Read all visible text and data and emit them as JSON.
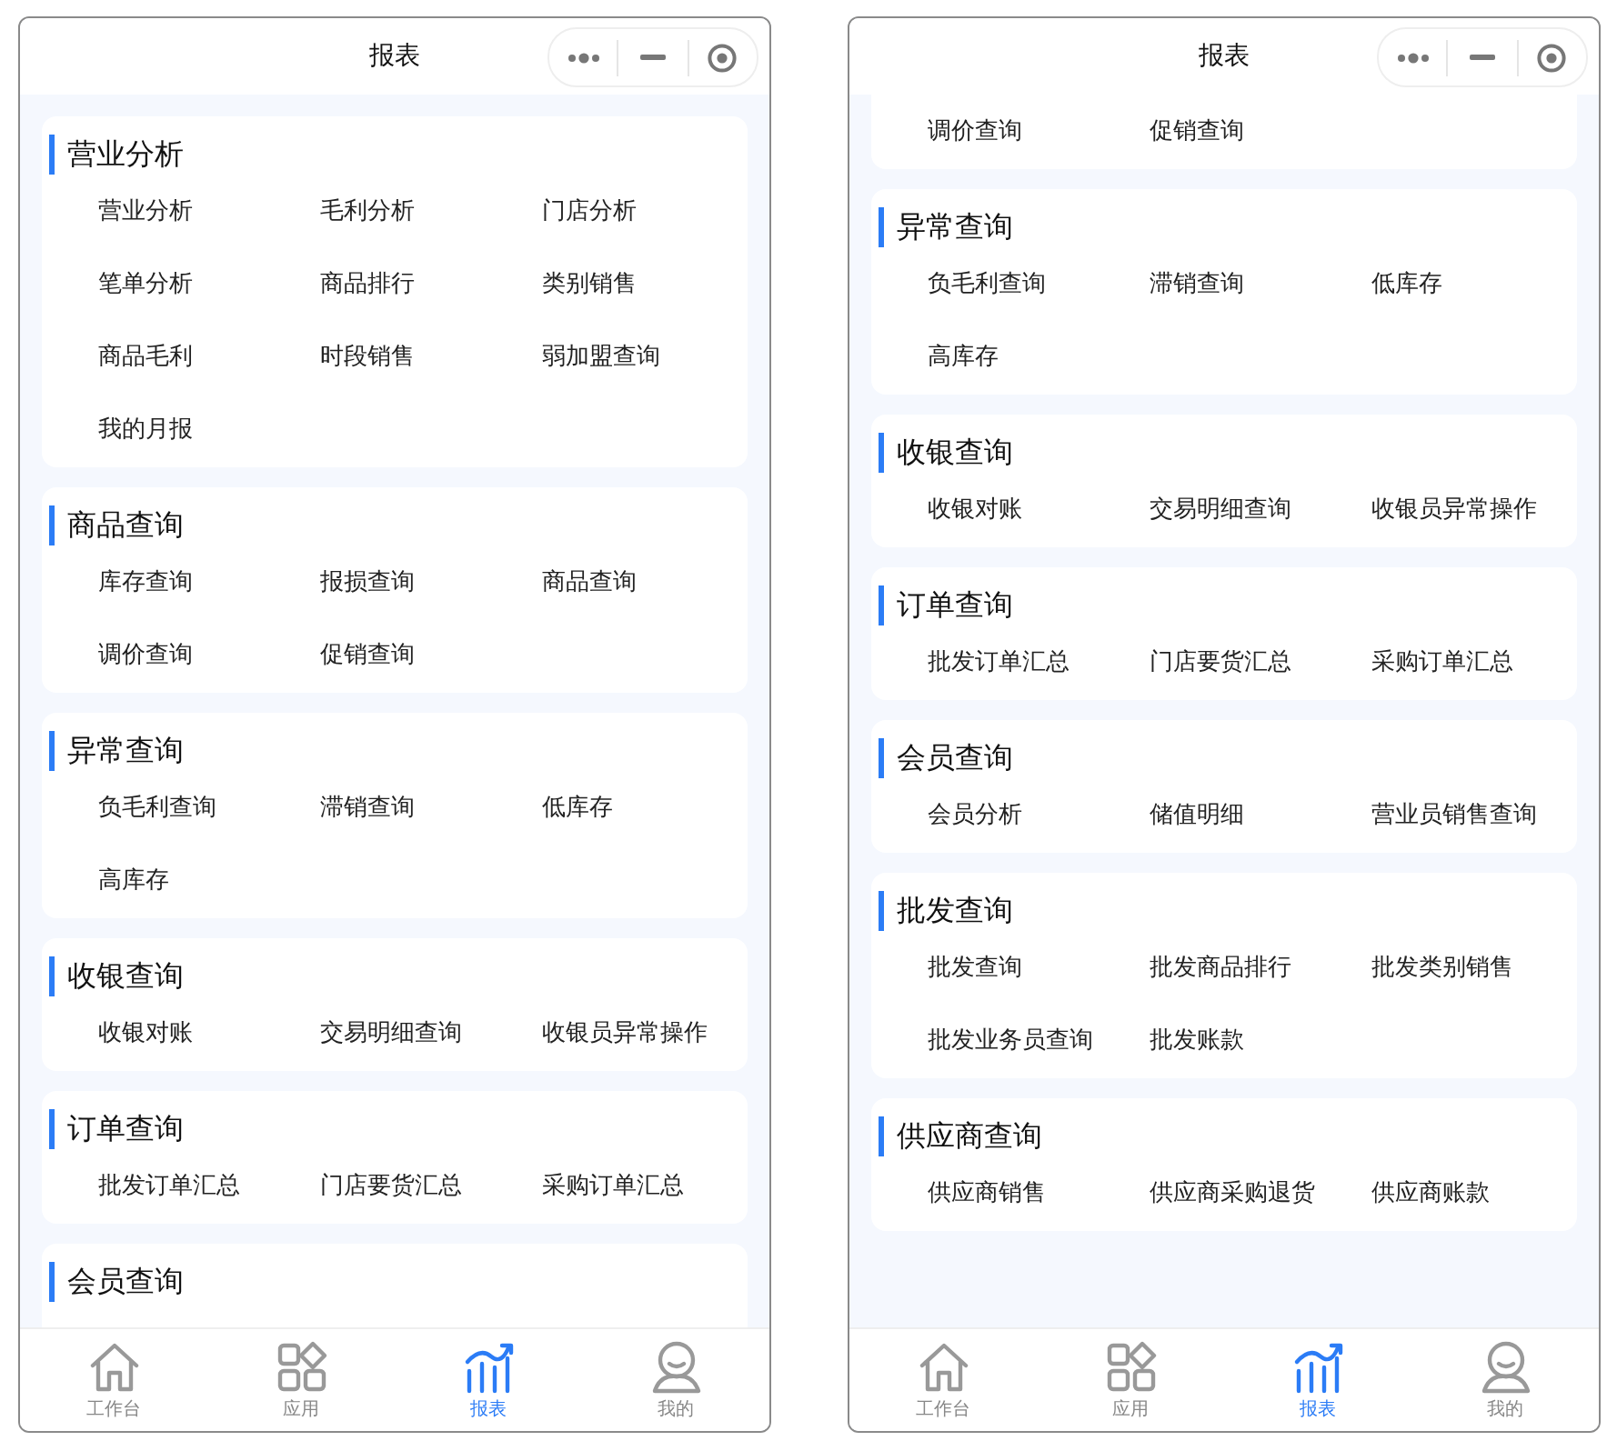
{
  "screens": [
    {
      "title": "报表",
      "sections": [
        {
          "title": "营业分析",
          "items": [
            "营业分析",
            "毛利分析",
            "门店分析",
            "笔单分析",
            "商品排行",
            "类别销售",
            "商品毛利",
            "时段销售",
            "弱加盟查询",
            "我的月报"
          ]
        },
        {
          "title": "商品查询",
          "items": [
            "库存查询",
            "报损查询",
            "商品查询",
            "调价查询",
            "促销查询"
          ]
        },
        {
          "title": "异常查询",
          "items": [
            "负毛利查询",
            "滞销查询",
            "低库存",
            "高库存"
          ]
        },
        {
          "title": "收银查询",
          "items": [
            "收银对账",
            "交易明细查询",
            "收银员异常操作"
          ]
        },
        {
          "title": "订单查询",
          "items": [
            "批发订单汇总",
            "门店要货汇总",
            "采购订单汇总"
          ]
        },
        {
          "title": "会员查询"
        }
      ],
      "tabs": [
        {
          "label": "工作台",
          "kind": "home",
          "selected": false
        },
        {
          "label": "应用",
          "kind": "apps",
          "selected": false
        },
        {
          "label": "报表",
          "kind": "chart",
          "selected": true
        },
        {
          "label": "我的",
          "kind": "user",
          "selected": false
        }
      ]
    },
    {
      "title": "报表",
      "sections": [
        {
          "items": [
            "调价查询",
            "促销查询"
          ]
        },
        {
          "title": "异常查询",
          "items": [
            "负毛利查询",
            "滞销查询",
            "低库存",
            "高库存"
          ]
        },
        {
          "title": "收银查询",
          "items": [
            "收银对账",
            "交易明细查询",
            "收银员异常操作"
          ]
        },
        {
          "title": "订单查询",
          "items": [
            "批发订单汇总",
            "门店要货汇总",
            "采购订单汇总"
          ]
        },
        {
          "title": "会员查询",
          "items": [
            "会员分析",
            "储值明细",
            "营业员销售查询"
          ]
        },
        {
          "title": "批发查询",
          "items": [
            "批发查询",
            "批发商品排行",
            "批发类别销售",
            "批发业务员查询",
            "批发账款"
          ]
        },
        {
          "title": "供应商查询",
          "items": [
            "供应商销售",
            "供应商采购退货",
            "供应商账款"
          ]
        }
      ],
      "tabs": [
        {
          "label": "工作台",
          "kind": "home",
          "selected": false
        },
        {
          "label": "应用",
          "kind": "apps",
          "selected": false
        },
        {
          "label": "报表",
          "kind": "chart",
          "selected": true
        },
        {
          "label": "我的",
          "kind": "user",
          "selected": false
        }
      ]
    }
  ]
}
